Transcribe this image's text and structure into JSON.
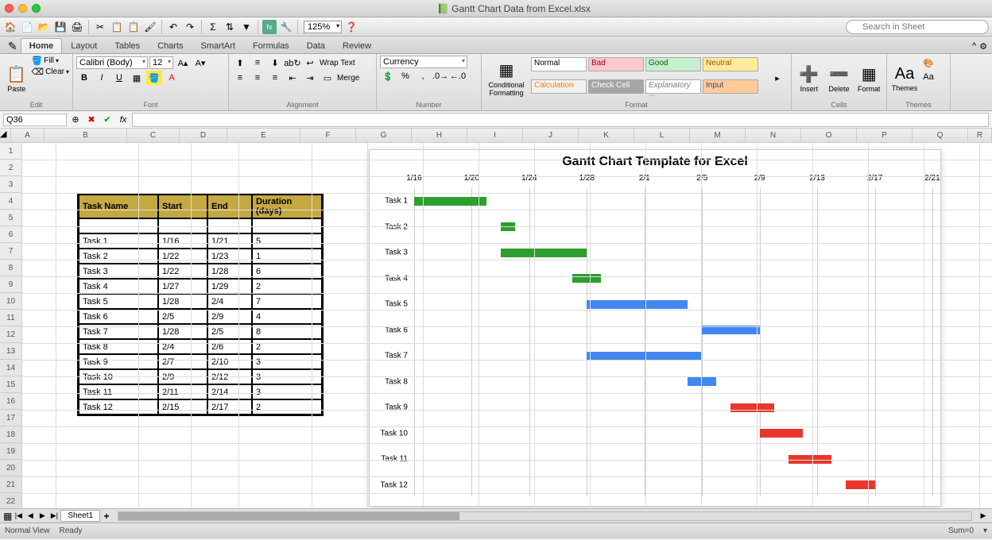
{
  "window": {
    "title": "Gantt Chart Data from Excel.xlsx"
  },
  "qat": {
    "zoom": "125%",
    "search_placeholder": "Search in Sheet"
  },
  "tabs": [
    "Home",
    "Layout",
    "Tables",
    "Charts",
    "SmartArt",
    "Formulas",
    "Data",
    "Review"
  ],
  "ribbon": {
    "groups": {
      "edit": "Edit",
      "font": "Font",
      "alignment": "Alignment",
      "number": "Number",
      "format": "Format",
      "cells": "Cells",
      "themes": "Themes"
    },
    "paste": "Paste",
    "fill": "Fill",
    "clear": "Clear",
    "font_name": "Calibri (Body)",
    "font_size": "12",
    "wrap": "Wrap Text",
    "merge": "Merge",
    "number_format": "Currency",
    "cond_fmt": "Conditional\nFormatting",
    "styles": {
      "normal": "Normal",
      "bad": "Bad",
      "good": "Good",
      "neutral": "Neutral",
      "calc": "Calculation",
      "check": "Check Cell",
      "expl": "Explanatory ...",
      "input": "Input"
    },
    "insert": "Insert",
    "delete": "Delete",
    "format": "Format",
    "themes": "Themes"
  },
  "formula_bar": {
    "name_box": "Q36",
    "formula": ""
  },
  "columns": [
    "A",
    "B",
    "C",
    "D",
    "E",
    "F",
    "G",
    "H",
    "I",
    "J",
    "K",
    "L",
    "M",
    "N",
    "O",
    "P",
    "Q",
    "R"
  ],
  "rows": [
    1,
    2,
    3,
    4,
    5,
    6,
    7,
    8,
    9,
    10,
    11,
    12,
    13,
    14,
    15,
    16,
    17,
    18,
    19,
    20,
    21,
    22
  ],
  "table": {
    "headers": [
      "Task Name",
      "Start",
      "End",
      "Duration (days)"
    ],
    "rows": [
      [
        "Task 1",
        "1/16",
        "1/21",
        "5"
      ],
      [
        "Task 2",
        "1/22",
        "1/23",
        "1"
      ],
      [
        "Task 3",
        "1/22",
        "1/28",
        "6"
      ],
      [
        "Task 4",
        "1/27",
        "1/29",
        "2"
      ],
      [
        "Task 5",
        "1/28",
        "2/4",
        "7"
      ],
      [
        "Task 6",
        "2/5",
        "2/9",
        "4"
      ],
      [
        "Task 7",
        "1/28",
        "2/5",
        "8"
      ],
      [
        "Task 8",
        "2/4",
        "2/6",
        "2"
      ],
      [
        "Task 9",
        "2/7",
        "2/10",
        "3"
      ],
      [
        "Task 10",
        "2/9",
        "2/12",
        "3"
      ],
      [
        "Task 11",
        "2/11",
        "2/14",
        "3"
      ],
      [
        "Task 12",
        "2/15",
        "2/17",
        "2"
      ]
    ]
  },
  "chart_data": {
    "type": "gantt",
    "title": "Gantt Chart Template for Excel",
    "x_ticks": [
      "1/16",
      "1/20",
      "1/24",
      "1/28",
      "2/1",
      "2/5",
      "2/9",
      "2/13",
      "2/17",
      "2/21"
    ],
    "x_range_days": [
      16,
      52
    ],
    "tasks": [
      {
        "name": "Task 1",
        "start": 16,
        "dur": 5,
        "color": "g"
      },
      {
        "name": "Task 2",
        "start": 22,
        "dur": 1,
        "color": "g"
      },
      {
        "name": "Task 3",
        "start": 22,
        "dur": 6,
        "color": "g"
      },
      {
        "name": "Task 4",
        "start": 27,
        "dur": 2,
        "color": "g"
      },
      {
        "name": "Task 5",
        "start": 28,
        "dur": 7,
        "color": "b"
      },
      {
        "name": "Task 6",
        "start": 36,
        "dur": 4,
        "color": "b"
      },
      {
        "name": "Task 7",
        "start": 28,
        "dur": 8,
        "color": "b"
      },
      {
        "name": "Task 8",
        "start": 35,
        "dur": 2,
        "color": "b"
      },
      {
        "name": "Task 9",
        "start": 38,
        "dur": 3,
        "color": "r"
      },
      {
        "name": "Task 10",
        "start": 40,
        "dur": 3,
        "color": "r"
      },
      {
        "name": "Task 11",
        "start": 42,
        "dur": 3,
        "color": "r"
      },
      {
        "name": "Task 12",
        "start": 46,
        "dur": 2,
        "color": "r"
      }
    ]
  },
  "sheet_tabs": {
    "active": "Sheet1"
  },
  "status": {
    "view": "Normal View",
    "ready": "Ready",
    "sum": "Sum=0"
  }
}
